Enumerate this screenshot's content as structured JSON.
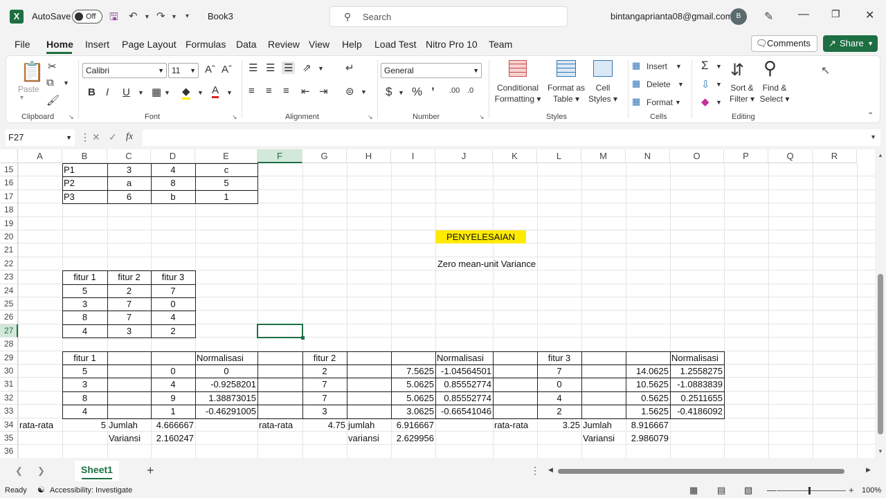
{
  "titlebar": {
    "autosave_label": "AutoSave",
    "autosave_state": "Off",
    "book_name": "Book3",
    "search_placeholder": "Search",
    "account_email": "bintangaprianta08@gmail.com",
    "avatar_initial": "B"
  },
  "menu": {
    "items": [
      "File",
      "Home",
      "Insert",
      "Page Layout",
      "Formulas",
      "Data",
      "Review",
      "View",
      "Help",
      "Load Test",
      "Nitro Pro 10",
      "Team"
    ],
    "active": "Home",
    "comments_label": "Comments",
    "share_label": "Share"
  },
  "ribbon": {
    "clipboard": {
      "paste_label": "Paste",
      "group_label": "Clipboard"
    },
    "font": {
      "font_name": "Calibri",
      "font_size": "11",
      "group_label": "Font"
    },
    "alignment": {
      "group_label": "Alignment"
    },
    "number": {
      "format": "General",
      "group_label": "Number"
    },
    "styles": {
      "conditional_formatting": [
        "Conditional",
        "Formatting"
      ],
      "format_as_table": [
        "Format as",
        "Table"
      ],
      "cell_styles": [
        "Cell",
        "Styles"
      ],
      "group_label": "Styles"
    },
    "cells": {
      "insert": "Insert",
      "delete": "Delete",
      "format": "Format",
      "group_label": "Cells"
    },
    "editing": {
      "sort_filter": [
        "Sort &",
        "Filter"
      ],
      "find_select": [
        "Find &",
        "Select"
      ],
      "group_label": "Editing"
    }
  },
  "formula_bar": {
    "name_box": "F27",
    "formula": ""
  },
  "grid": {
    "columns": [
      "A",
      "B",
      "C",
      "D",
      "E",
      "F",
      "G",
      "H",
      "I",
      "J",
      "K",
      "L",
      "M",
      "N",
      "O",
      "P",
      "Q",
      "R"
    ],
    "rows": [
      "15",
      "16",
      "17",
      "18",
      "19",
      "20",
      "21",
      "22",
      "23",
      "24",
      "25",
      "26",
      "27",
      "28",
      "29",
      "30",
      "31",
      "32",
      "33",
      "34",
      "35",
      "36"
    ],
    "selected_column": "F",
    "selected_row": "27"
  },
  "cells": {
    "B15": "P1",
    "C15": "3",
    "D15": "4",
    "E15": "c",
    "B16": "P2",
    "C16": "a",
    "D16": "8",
    "E16": "5",
    "B17": "P3",
    "C17": "6",
    "D17": "b",
    "E17": "1",
    "J20": "PENYELESAIAN",
    "J22": "Zero mean-unit Variance",
    "B23": "fitur 1",
    "C23": "fitur 2",
    "D23": "fitur 3",
    "B24": "5",
    "C24": "2",
    "D24": "7",
    "B25": "3",
    "C25": "7",
    "D25": "0",
    "B26": "8",
    "C26": "7",
    "D26": "4",
    "B27": "4",
    "C27": "3",
    "D27": "2",
    "B29": "fitur 1",
    "E29": "Normalisasi",
    "G29": "fitur 2",
    "J29": "Normalisasi",
    "L29": "fitur 3",
    "O29": "Normalisasi",
    "B30": "5",
    "D30": "0",
    "E30": "0",
    "G30": "2",
    "I30": "7.5625",
    "J30": "-1.04564501",
    "L30": "7",
    "N30": "14.0625",
    "O30": "1.2558275",
    "B31": "3",
    "D31": "4",
    "E31": "-0.9258201",
    "G31": "7",
    "I31": "5.0625",
    "J31": "0.85552774",
    "L31": "0",
    "N31": "10.5625",
    "O31": "-1.0883839",
    "B32": "8",
    "D32": "9",
    "E32": "1.38873015",
    "G32": "7",
    "I32": "5.0625",
    "J32": "0.85552774",
    "L32": "4",
    "N32": "0.5625",
    "O32": "0.2511655",
    "B33": "4",
    "D33": "1",
    "E33": "-0.46291005",
    "G33": "3",
    "I33": "3.0625",
    "J33": "-0.66541046",
    "L33": "2",
    "N33": "1.5625",
    "O33": "-0.4186092",
    "A34": "rata-rata",
    "B34": "5",
    "C34": "Jumlah",
    "D34": "4.666667",
    "F34": "rata-rata",
    "G34": "4.75",
    "H34": "jumlah",
    "I34": "6.916667",
    "K34": "rata-rata",
    "L34": "3.25",
    "M34": "Jumlah",
    "N34": "8.916667",
    "C35": "Variansi",
    "D35": "2.160247",
    "H35": "variansi",
    "I35": "2.629956",
    "M35": "Variansi",
    "N35": "2.986079"
  },
  "sheets": {
    "tabs": [
      "Sheet1"
    ],
    "active": "Sheet1"
  },
  "status": {
    "ready": "Ready",
    "accessibility": "Accessibility: Investigate",
    "zoom": "100%"
  },
  "colors": {
    "excel_green": "#1d6f42",
    "highlight_yellow": "#ffeb00"
  }
}
